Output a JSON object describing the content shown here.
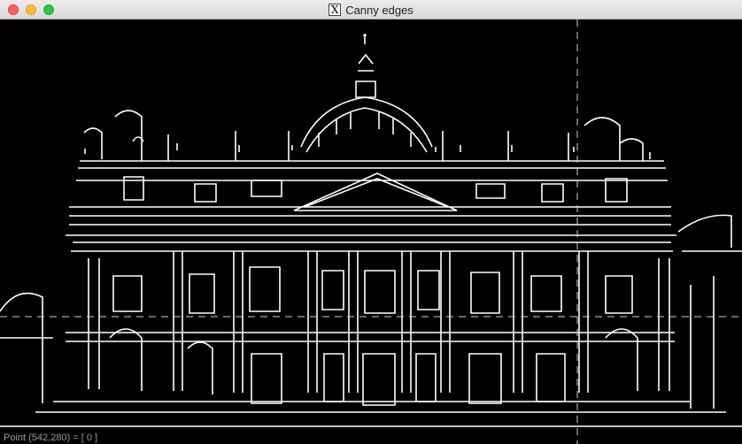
{
  "window": {
    "title": "Canny edges",
    "title_icon": "x11-icon",
    "controls": [
      "close",
      "minimize",
      "maximize"
    ]
  },
  "status": {
    "text": "Point (542,280) = [ 0 ]"
  },
  "colors": {
    "background": "#000000",
    "edges": "#ffffff"
  }
}
